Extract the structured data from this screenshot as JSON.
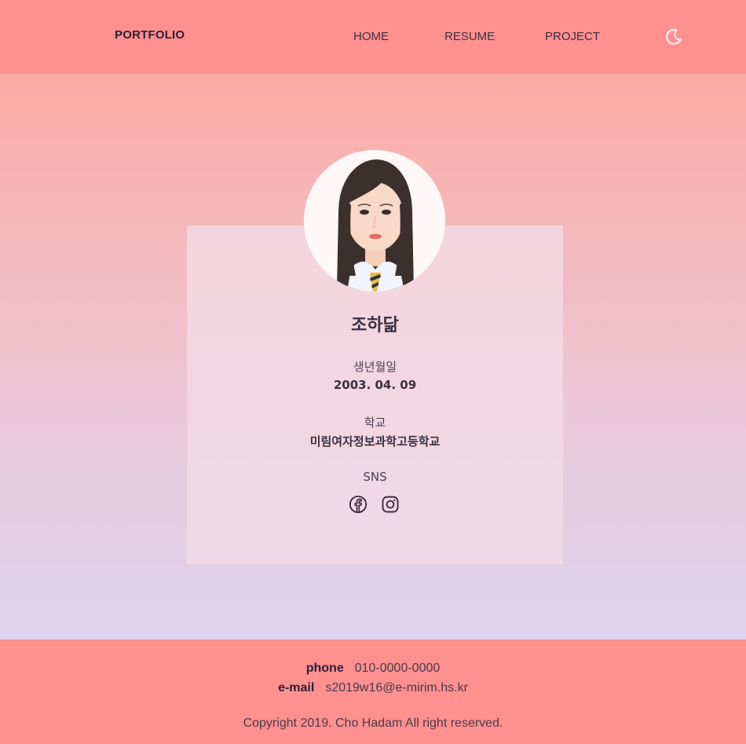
{
  "header": {
    "brand": "PORTFOLIO",
    "nav": [
      {
        "label": "HOME"
      },
      {
        "label": "RESUME"
      },
      {
        "label": "PROJECT"
      }
    ],
    "theme_toggle_icon": "moon-icon"
  },
  "profile": {
    "name": "조하닮",
    "birth_label": "생년월일",
    "birth_value": "2003. 04. 09",
    "school_label": "학교",
    "school_value": "미림여자정보과학고등학교",
    "sns_label": "SNS",
    "sns_icons": [
      "facebook-icon",
      "instagram-icon"
    ]
  },
  "footer": {
    "phone_label": "phone",
    "phone_value": "010-0000-0000",
    "email_label": "e-mail",
    "email_value": "s2019w16@e-mirim.hs.kr",
    "copyright": "Copyright 2019. Cho Hadam All right reserved."
  },
  "colors": {
    "header_bg": "#ff9090",
    "footer_bg": "#ff9090",
    "gradient_top": "#fbaba3",
    "gradient_bottom": "#ddd3ee",
    "card_bg": "#f4dbe6",
    "text_dark": "#3a2f3f",
    "moon_icon": "#fde8ee"
  }
}
